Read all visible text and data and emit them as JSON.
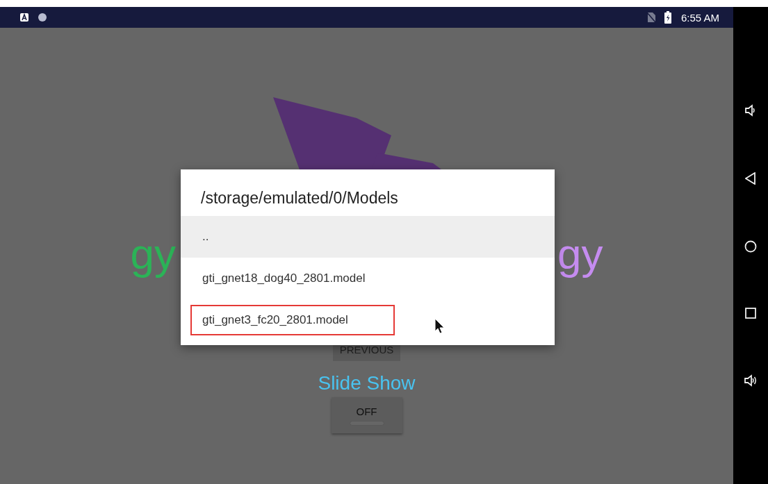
{
  "status_bar": {
    "time": "6:55 AM"
  },
  "app": {
    "logo_text_left": "gy",
    "logo_text_right": "gy",
    "previous_button": "PREVIOUS",
    "slide_show_label": "Slide Show",
    "slide_show_button": "OFF"
  },
  "dialog": {
    "title": "/storage/emulated/0/Models",
    "items": [
      {
        "label": "..",
        "selected": true,
        "highlighted": false
      },
      {
        "label": "gti_gnet18_dog40_2801.model",
        "selected": false,
        "highlighted": false
      },
      {
        "label": "gti_gnet3_fc20_2801.model",
        "selected": false,
        "highlighted": true
      }
    ]
  }
}
